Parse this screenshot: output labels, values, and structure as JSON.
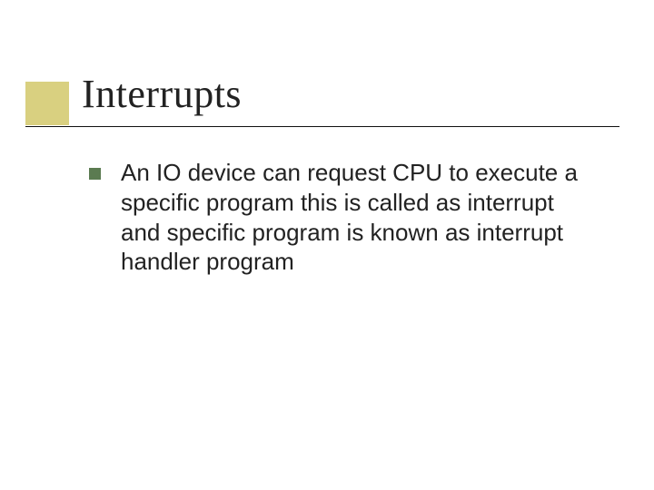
{
  "title": "Interrupts",
  "bullets": [
    {
      "text": "An IO device can request CPU to execute a specific program this is called as interrupt and specific program is known as interrupt handler program"
    }
  ],
  "colors": {
    "accent_box": "#d9d080",
    "bullet": "#5b7b51"
  }
}
